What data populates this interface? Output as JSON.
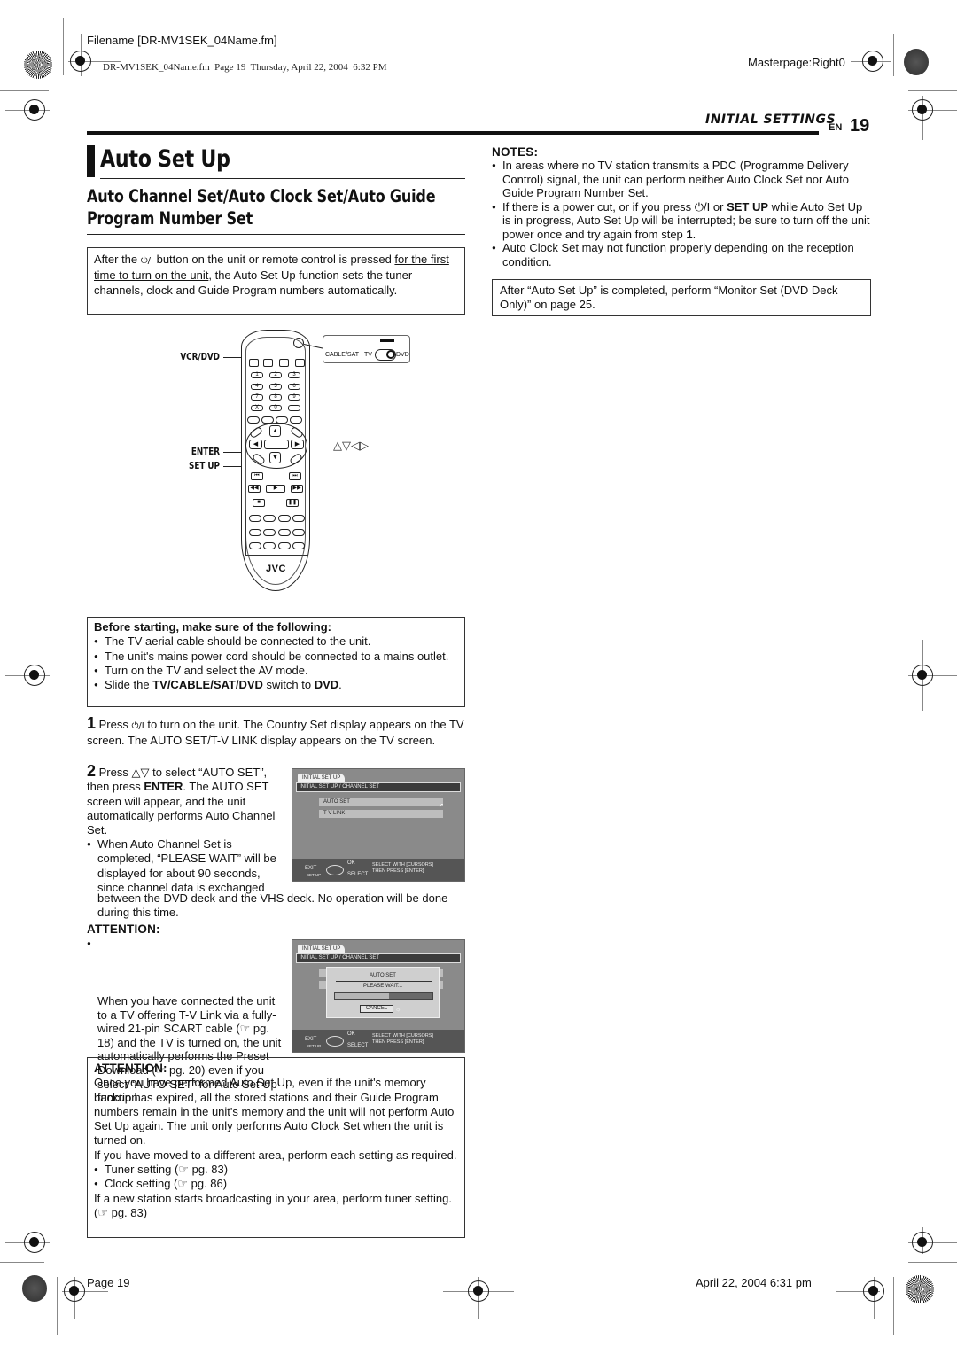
{
  "print_slug": {
    "filename": "Filename [DR-MV1SEK_04Name.fm]",
    "fm_line": "DR-MV1SEK_04Name.fm  Page 19  Thursday, April 22, 2004  6:32 PM",
    "masterpage": "Masterpage:Right0"
  },
  "header": {
    "section": "INITIAL SETTINGS",
    "lang": "EN",
    "page_number": "19"
  },
  "title": "Auto Set Up",
  "subtitle": "Auto Channel Set/Auto Clock Set/Auto Guide Program Number Set",
  "intro": {
    "part1": "After the ",
    "power_symbol": "⏻/I",
    "part2": " button on the unit or remote control is pressed ",
    "underlined": "for the first time to turn on the unit",
    "part3": ", the Auto Set Up function sets the tuner channels, clock and Guide Program numbers automatically."
  },
  "remote": {
    "labels": {
      "vcr_dvd": "VCR/DVD",
      "enter": "ENTER",
      "set_up": "SET UP",
      "arrows": "△▽◁▷"
    },
    "switch": {
      "cable_sat": "CABLE/SAT",
      "tv": "TV",
      "dvd": "DVD"
    },
    "number_keys": [
      "1",
      "2",
      "3",
      "4",
      "5",
      "6",
      "7",
      "8",
      "9",
      "X",
      "0",
      ""
    ],
    "brand": "JVC"
  },
  "before_starting": {
    "heading": "Before starting, make sure of the following:",
    "items": [
      "The TV aerial cable should be connected to the unit.",
      "The unit's mains power cord should be connected to a mains outlet.",
      "Turn on the TV and select the AV mode."
    ],
    "last_item": {
      "pre": "Slide the ",
      "bold1": "TV/CABLE/SAT/DVD",
      "mid": " switch to ",
      "bold2": "DVD",
      "post": "."
    }
  },
  "steps": [
    {
      "number": "1",
      "pre": "Press ",
      "symbol": "⏻/I",
      "text": " to turn on the unit. The Country Set display appears on the TV screen. The AUTO SET/T-V LINK display appears on the TV screen."
    },
    {
      "number": "2",
      "pre": "Press △▽ to select “AUTO SET”, then press ",
      "bold": "ENTER",
      "text": ". The AUTO SET screen will appear, and the unit automatically performs Auto Channel Set.",
      "note": "When Auto Channel Set is completed, “PLEASE WAIT” will be displayed for about 90 seconds, since channel data is exchanged between the DVD deck and the VHS deck. No operation will be done during this time."
    }
  ],
  "osd_screen_1": {
    "tab": "INITIAL SET UP",
    "path": "INITIAL SET UP / CHANNEL SET",
    "items": [
      "AUTO SET",
      "T-V LINK"
    ],
    "footer": {
      "exit": "EXIT",
      "set_up": "SET UP",
      "ok": "OK",
      "select": "SELECT",
      "hint1": "SELECT WITH [CURSORS]",
      "hint2": "THEN PRESS [ENTER]"
    }
  },
  "attention_1": {
    "heading": "ATTENTION:",
    "text": "When you have connected the unit to a TV offering T-V Link via a fully-wired 21-pin SCART cable (☞ pg. 18) and the TV is turned on, the unit automatically performs the Preset Download (☞ pg. 20) even if you select “AUTO SET” for Auto Set Up function."
  },
  "osd_screen_2": {
    "tab": "INITIAL SET UP",
    "path": "INITIAL SET UP / CHANNEL SET",
    "dialog_title": "AUTO SET",
    "dialog_message": "PLEASE WAIT...",
    "progress": 0.55,
    "cancel": "CANCEL",
    "footer": {
      "exit": "EXIT",
      "set_up": "SET UP",
      "ok": "OK",
      "select": "SELECT",
      "hint1": "SELECT WITH [CURSORS]",
      "hint2": "THEN PRESS [ENTER]"
    }
  },
  "attention_2": {
    "heading": "ATTENTION:",
    "para1": "Once you have performed Auto Set Up, even if the unit's memory backup has expired, all the stored stations and their Guide Program numbers remain in the unit's memory and the unit will not perform Auto Set Up again. The unit only performs Auto Clock Set when the unit is turned on.",
    "para2": "If you have moved to a different area, perform each setting as required.",
    "items": [
      "Tuner setting (☞ pg. 83)",
      "Clock setting (☞ pg. 86)"
    ],
    "para3": "If a new station starts broadcasting in your area, perform tuner setting. (☞ pg. 83)"
  },
  "notes": {
    "heading": "NOTES:",
    "items": [
      "In areas where no TV station transmits a PDC (Programme Delivery Control) signal, the unit can perform neither Auto Clock Set nor Auto Guide Program Number Set.",
      "Auto Clock Set may not function properly depending on the reception condition."
    ],
    "item2": {
      "pre": "If there is a power cut, or if you press ⏻/I or ",
      "bold": "SET UP",
      "mid": " while Auto Set Up is in progress, Auto Set Up will be interrupted; be sure to turn off the unit power once and try again from step ",
      "bold2": "1",
      "post": "."
    }
  },
  "monitor_note": "After “Auto Set Up” is completed, perform “Monitor Set (DVD Deck Only)” on page 25.",
  "footer": {
    "page": "Page 19",
    "date": "April 22, 2004 6:31 pm"
  }
}
